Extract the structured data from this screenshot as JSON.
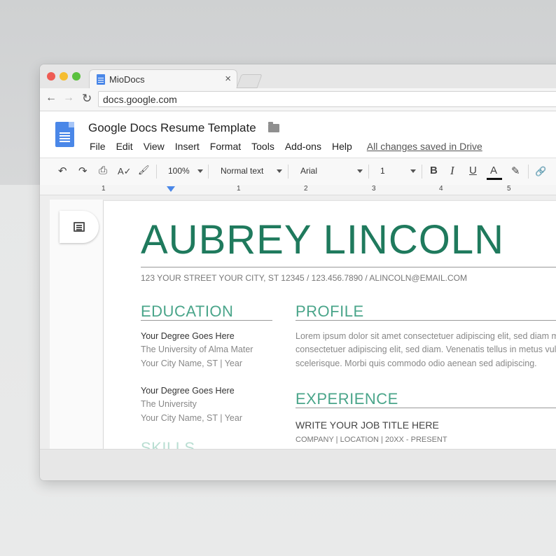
{
  "browser": {
    "tab_title": "MioDocs",
    "tab_close": "×",
    "url": "docs.google.com",
    "back": "←",
    "forward": "→",
    "reload": "↻"
  },
  "docs": {
    "title": "Google Docs Resume Template",
    "menu": [
      "File",
      "Edit",
      "View",
      "Insert",
      "Format",
      "Tools",
      "Add-ons",
      "Help"
    ],
    "saved_status": "All changes saved in Drive"
  },
  "toolbar": {
    "undo": "↶",
    "redo": "↷",
    "print": "⎙",
    "spellcheck": "A✓",
    "paint_format": "🖌",
    "zoom": "100%",
    "style": "Normal text",
    "font": "Arial",
    "font_size": "1",
    "bold": "B",
    "italic": "I",
    "underline": "U",
    "text_color": "A",
    "highlight": "✎",
    "link": "🔗"
  },
  "ruler": [
    "1",
    "1",
    "2",
    "3",
    "4",
    "5"
  ],
  "resume": {
    "name": "AUBREY LINCOLN",
    "contact": "123 YOUR STREET YOUR CITY, ST 12345  /  123.456.7890  /  ALINCOLN@EMAIL.COM",
    "education": {
      "heading": "EDUCATION",
      "entries": [
        {
          "degree": "Your Degree Goes Here",
          "school": "The University of Alma Mater",
          "place": "Your City Name, ST  |  Year"
        },
        {
          "degree": "Your Degree Goes Here",
          "school": "The University",
          "place": "Your City Name, ST  |  Year"
        }
      ]
    },
    "profile": {
      "heading": "PROFILE",
      "lines": [
        "Lorem ipsum dolor sit amet consectetuer adipiscing elit, sed diam ma",
        "consectetuer adipiscing elit, sed diam. Venenatis tellus in metus vulpu",
        "scelerisque. Morbi quis commodo odio aenean sed adipiscing."
      ]
    },
    "experience": {
      "heading": "EXPERIENCE",
      "job_title": "WRITE YOUR JOB TITLE HERE",
      "job_meta": "COMPANY  |  LOCATION  |  20XX - PRESENT"
    },
    "skills_heading": "SKILLS"
  }
}
